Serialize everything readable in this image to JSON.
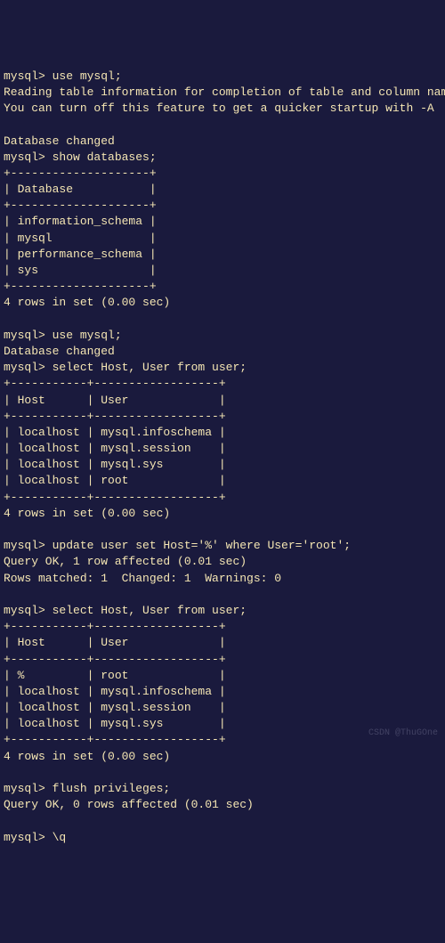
{
  "lines": [
    "mysql> use mysql;",
    "Reading table information for completion of table and column names",
    "You can turn off this feature to get a quicker startup with -A",
    "",
    "Database changed",
    "mysql> show databases;",
    "+--------------------+",
    "| Database           |",
    "+--------------------+",
    "| information_schema |",
    "| mysql              |",
    "| performance_schema |",
    "| sys                |",
    "+--------------------+",
    "4 rows in set (0.00 sec)",
    "",
    "mysql> use mysql;",
    "Database changed",
    "mysql> select Host, User from user;",
    "+-----------+------------------+",
    "| Host      | User             |",
    "+-----------+------------------+",
    "| localhost | mysql.infoschema |",
    "| localhost | mysql.session    |",
    "| localhost | mysql.sys        |",
    "| localhost | root             |",
    "+-----------+------------------+",
    "4 rows in set (0.00 sec)",
    "",
    "mysql> update user set Host='%' where User='root';",
    "Query OK, 1 row affected (0.01 sec)",
    "Rows matched: 1  Changed: 1  Warnings: 0",
    "",
    "mysql> select Host, User from user;",
    "+-----------+------------------+",
    "| Host      | User             |",
    "+-----------+------------------+",
    "| %         | root             |",
    "| localhost | mysql.infoschema |",
    "| localhost | mysql.session    |",
    "| localhost | mysql.sys        |",
    "+-----------+------------------+",
    "4 rows in set (0.00 sec)",
    "",
    "mysql> flush privileges;",
    "Query OK, 0 rows affected (0.01 sec)",
    "",
    "mysql> \\q"
  ],
  "watermark": "CSDN @ThuGOne"
}
